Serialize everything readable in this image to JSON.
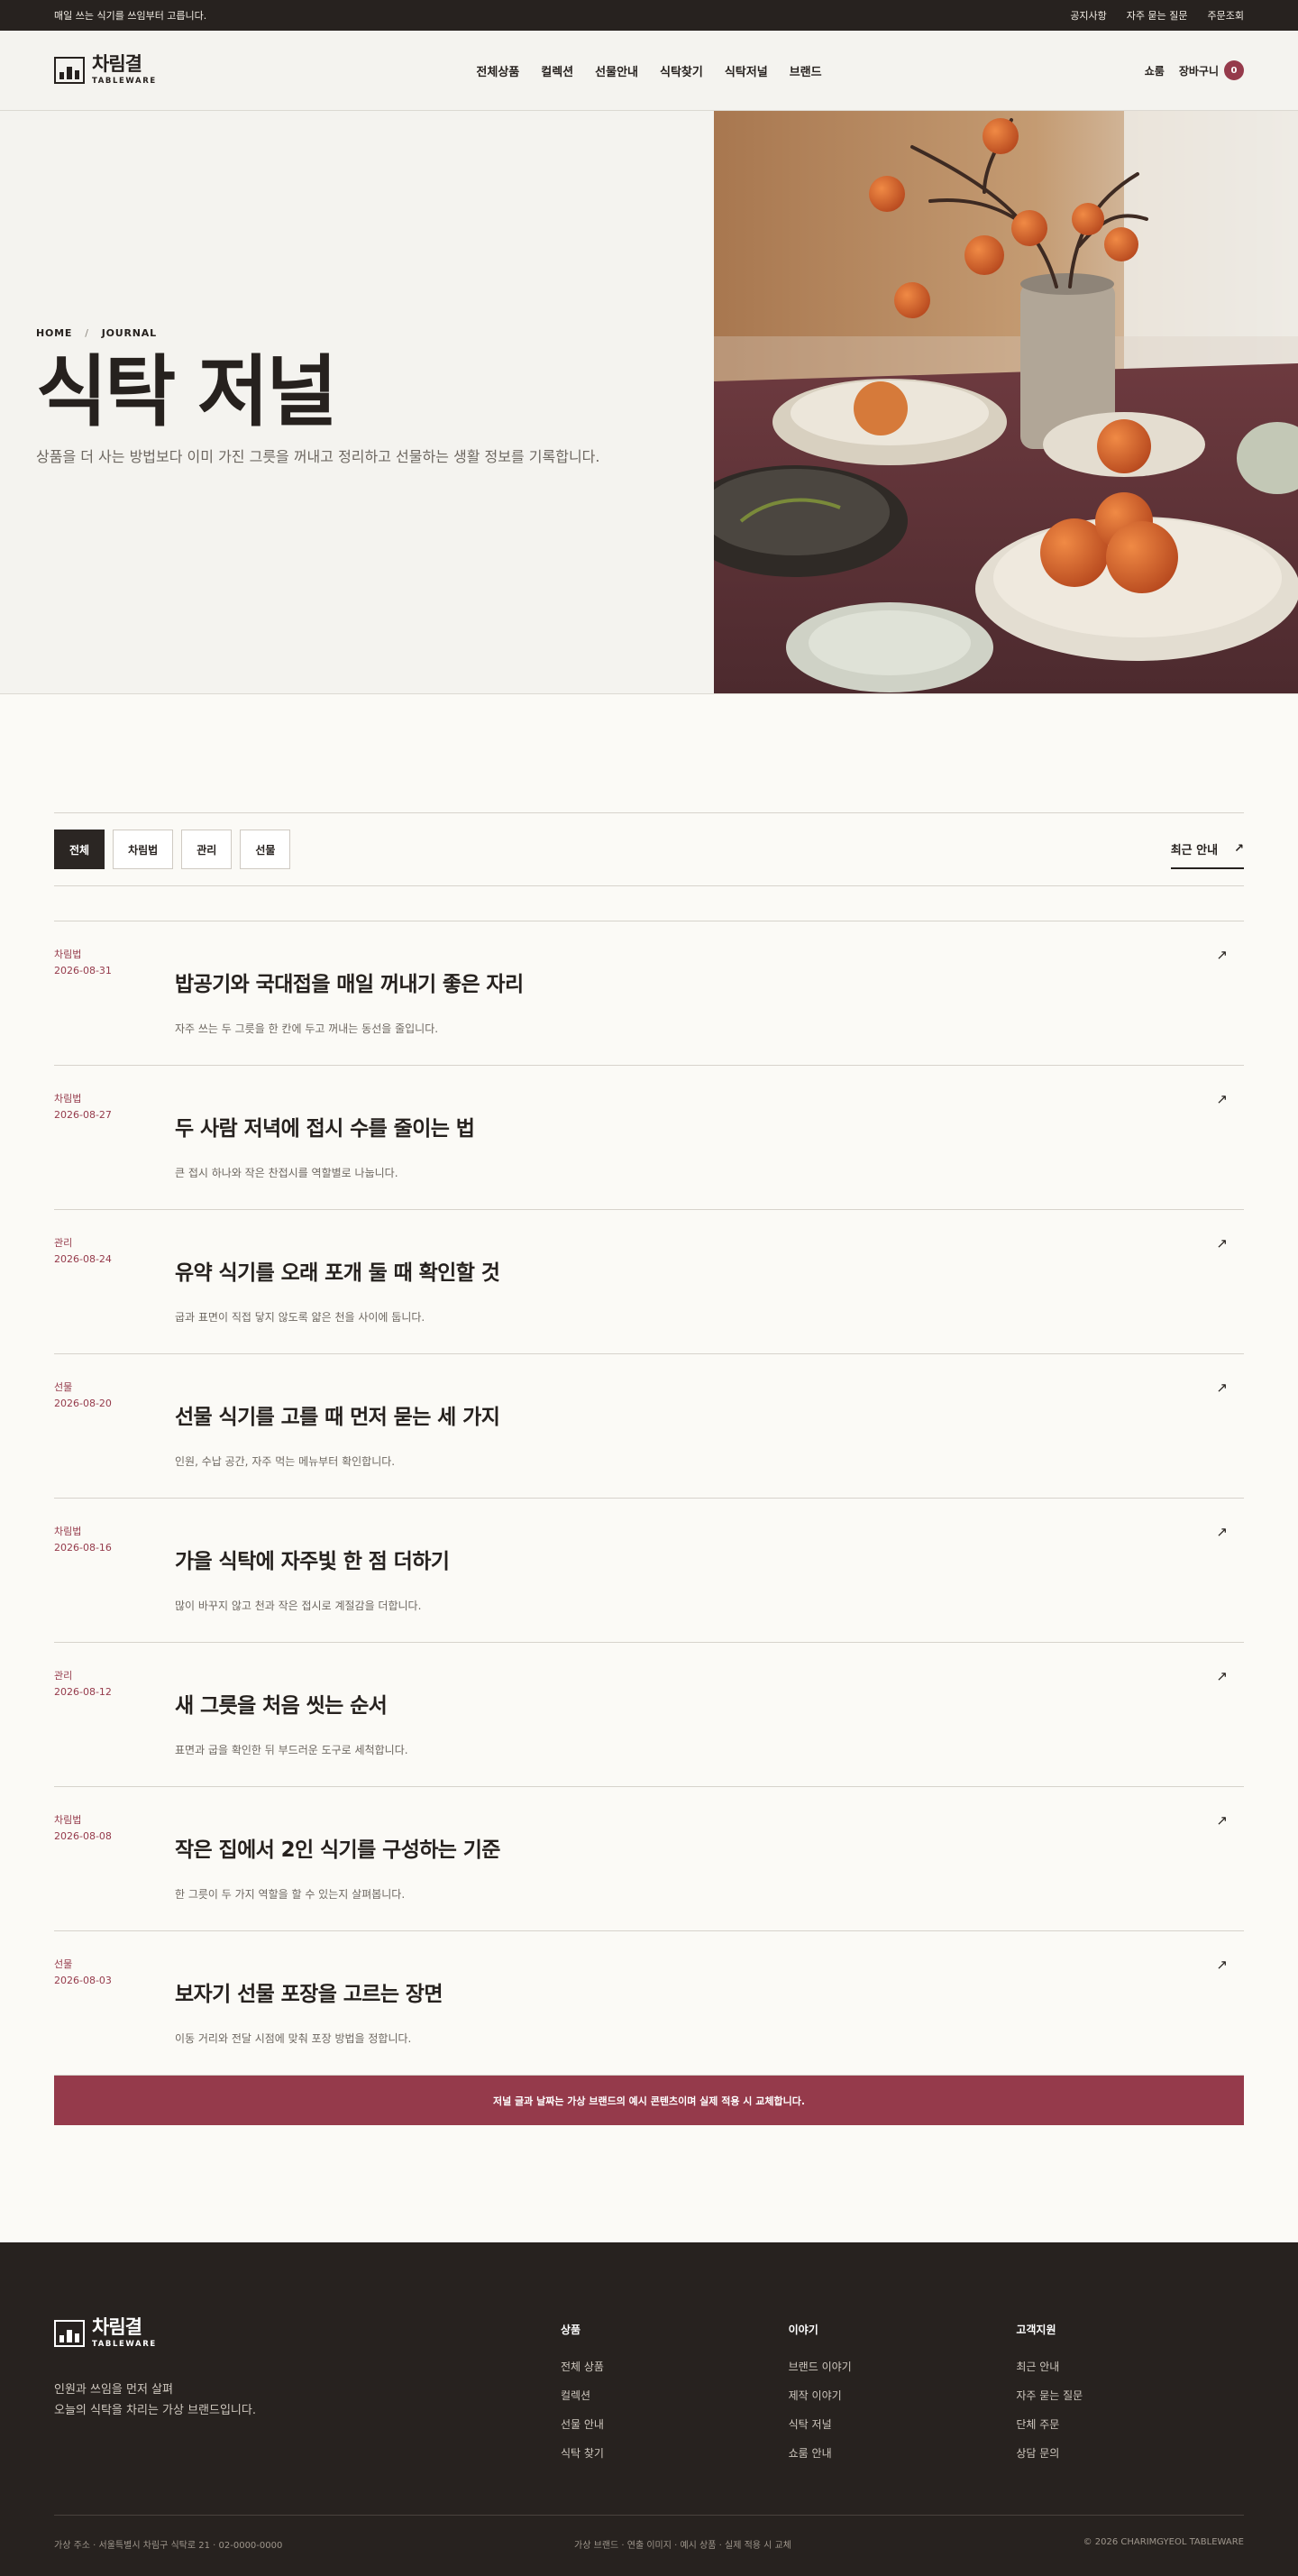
{
  "topbar": {
    "tagline": "매일 쓰는 식기를 쓰임부터 고릅니다.",
    "links": [
      "공지사항",
      "자주 묻는 질문",
      "주문조회"
    ]
  },
  "header": {
    "logo_ko": "차림결",
    "logo_en": "TABLEWARE",
    "nav": [
      "전체상품",
      "컬렉션",
      "선물안내",
      "식탁찾기",
      "식탁저널",
      "브랜드"
    ],
    "shop": "쇼룸",
    "cart": "장바구니",
    "cart_count": "0"
  },
  "hero": {
    "breadcrumb": [
      "HOME",
      "JOURNAL"
    ],
    "title": "식탁 저널",
    "desc": "상품을 더 사는 방법보다 이미 가진 그릇을 꺼내고 정리하고 선물하는 생활 정보를 기록합니다."
  },
  "filters": {
    "chips": [
      "전체",
      "차림법",
      "관리",
      "선물"
    ],
    "active": "전체",
    "sort": "최근 안내"
  },
  "posts": [
    {
      "cat": "차림법",
      "date": "2026-08-31",
      "title": "밥공기와 국대접을 매일 꺼내기 좋은 자리",
      "desc": "자주 쓰는 두 그릇을 한 칸에 두고 꺼내는 동선을 줄입니다."
    },
    {
      "cat": "차림법",
      "date": "2026-08-27",
      "title": "두 사람 저녁에 접시 수를 줄이는 법",
      "desc": "큰 접시 하나와 작은 찬접시를 역할별로 나눕니다."
    },
    {
      "cat": "관리",
      "date": "2026-08-24",
      "title": "유약 식기를 오래 포개 둘 때 확인할 것",
      "desc": "굽과 표면이 직접 닿지 않도록 얇은 천을 사이에 둡니다."
    },
    {
      "cat": "선물",
      "date": "2026-08-20",
      "title": "선물 식기를 고를 때 먼저 묻는 세 가지",
      "desc": "인원, 수납 공간, 자주 먹는 메뉴부터 확인합니다."
    },
    {
      "cat": "차림법",
      "date": "2026-08-16",
      "title": "가을 식탁에 자주빛 한 점 더하기",
      "desc": "많이 바꾸지 않고 천과 작은 접시로 계절감을 더합니다."
    },
    {
      "cat": "관리",
      "date": "2026-08-12",
      "title": "새 그릇을 처음 씻는 순서",
      "desc": "표면과 굽을 확인한 뒤 부드러운 도구로 세척합니다."
    },
    {
      "cat": "차림법",
      "date": "2026-08-08",
      "title": "작은 집에서 2인 식기를 구성하는 기준",
      "desc": "한 그릇이 두 가지 역할을 할 수 있는지 살펴봅니다."
    },
    {
      "cat": "선물",
      "date": "2026-08-03",
      "title": "보자기 선물 포장을 고르는 장면",
      "desc": "이동 거리와 전달 시점에 맞춰 포장 방법을 정합니다."
    }
  ],
  "notice": "저널 글과 날짜는 가상 브랜드의 예시 콘텐츠이며 실제 적용 시 교체합니다.",
  "footer": {
    "tagline_1": "인원과 쓰임을 먼저 살펴",
    "tagline_2": "오늘의 식탁을 차리는 가상 브랜드입니다.",
    "columns": [
      {
        "title": "상품",
        "items": [
          "전체 상품",
          "컬렉션",
          "선물 안내",
          "식탁 찾기"
        ]
      },
      {
        "title": "이야기",
        "items": [
          "브랜드 이야기",
          "제작 이야기",
          "식탁 저널",
          "쇼룸 안내"
        ]
      },
      {
        "title": "고객지원",
        "items": [
          "최근 안내",
          "자주 묻는 질문",
          "단체 주문",
          "상담 문의"
        ]
      }
    ],
    "address": "가상 주소 · 서울특별시 차림구 식탁로 21 · 02-0000-0000",
    "disclaimer": "가상 브랜드 · 연출 이미지 · 예시 상품 · 실제 적용 시 교체",
    "copyright": "© 2026 CHARIMGYEOL TABLEWARE"
  },
  "colors": {
    "accent": "#953a4b",
    "dark": "#27221f",
    "paper": "#fbfaf6"
  }
}
